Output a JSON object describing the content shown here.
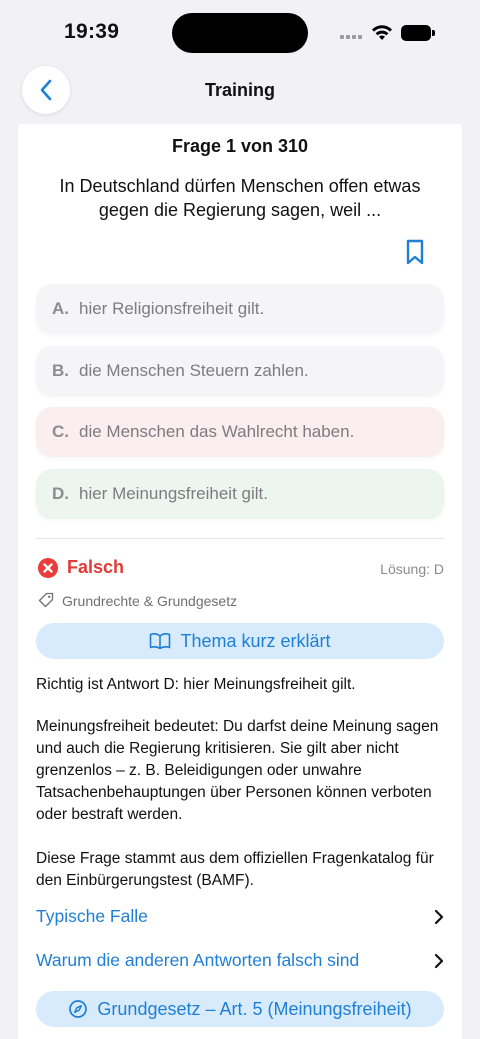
{
  "status": {
    "time": "19:39"
  },
  "nav": {
    "title": "Training",
    "back_icon": "chevron-left-icon"
  },
  "question": {
    "counter": "Frage 1 von 310",
    "text": "In Deutschland dürfen Menschen offen etwas gegen die Regierung sagen, weil ...",
    "bookmark_icon": "bookmark-icon"
  },
  "answers": [
    {
      "letter": "A.",
      "text": "hier Religionsfreiheit gilt.",
      "state": "neutral"
    },
    {
      "letter": "B.",
      "text": "die Menschen Steuern zahlen.",
      "state": "neutral"
    },
    {
      "letter": "C.",
      "text": "die Menschen das Wahlrecht haben.",
      "state": "wrong"
    },
    {
      "letter": "D.",
      "text": "hier Meinungsfreiheit gilt.",
      "state": "correct"
    }
  ],
  "result": {
    "label": "Falsch",
    "solution": "Lösung: D",
    "color": "#e23a36"
  },
  "topic_tag": "Grundrechte & Grundgesetz",
  "topic_button": {
    "label": "Thema kurz erklärt",
    "icon": "book-icon"
  },
  "explanation": {
    "p1": "Richtig ist Antwort D: hier Meinungsfreiheit gilt.",
    "p2": "Meinungsfreiheit bedeutet: Du darfst deine Meinung sagen und auch die Regierung kritisieren. Sie gilt aber nicht grenzenlos – z. B. Beleidigungen oder unwahre Tatsachenbehauptungen über Personen können verboten oder bestraft werden.",
    "p3": "Diese Frage stammt aus dem offiziellen Fragenkatalog für den Einbürgerungstest (BAMF)."
  },
  "links": {
    "typical_trap": "Typische Falle",
    "why_wrong": "Warum die anderen Antworten falsch sind"
  },
  "law_button": {
    "label": "Grundgesetz – Art. 5 (Meinungsfreiheit)",
    "icon": "compass-icon"
  },
  "colors": {
    "accent": "#1f7fd4",
    "accent_bg": "#d7ebfc",
    "error": "#ec3b3b"
  }
}
